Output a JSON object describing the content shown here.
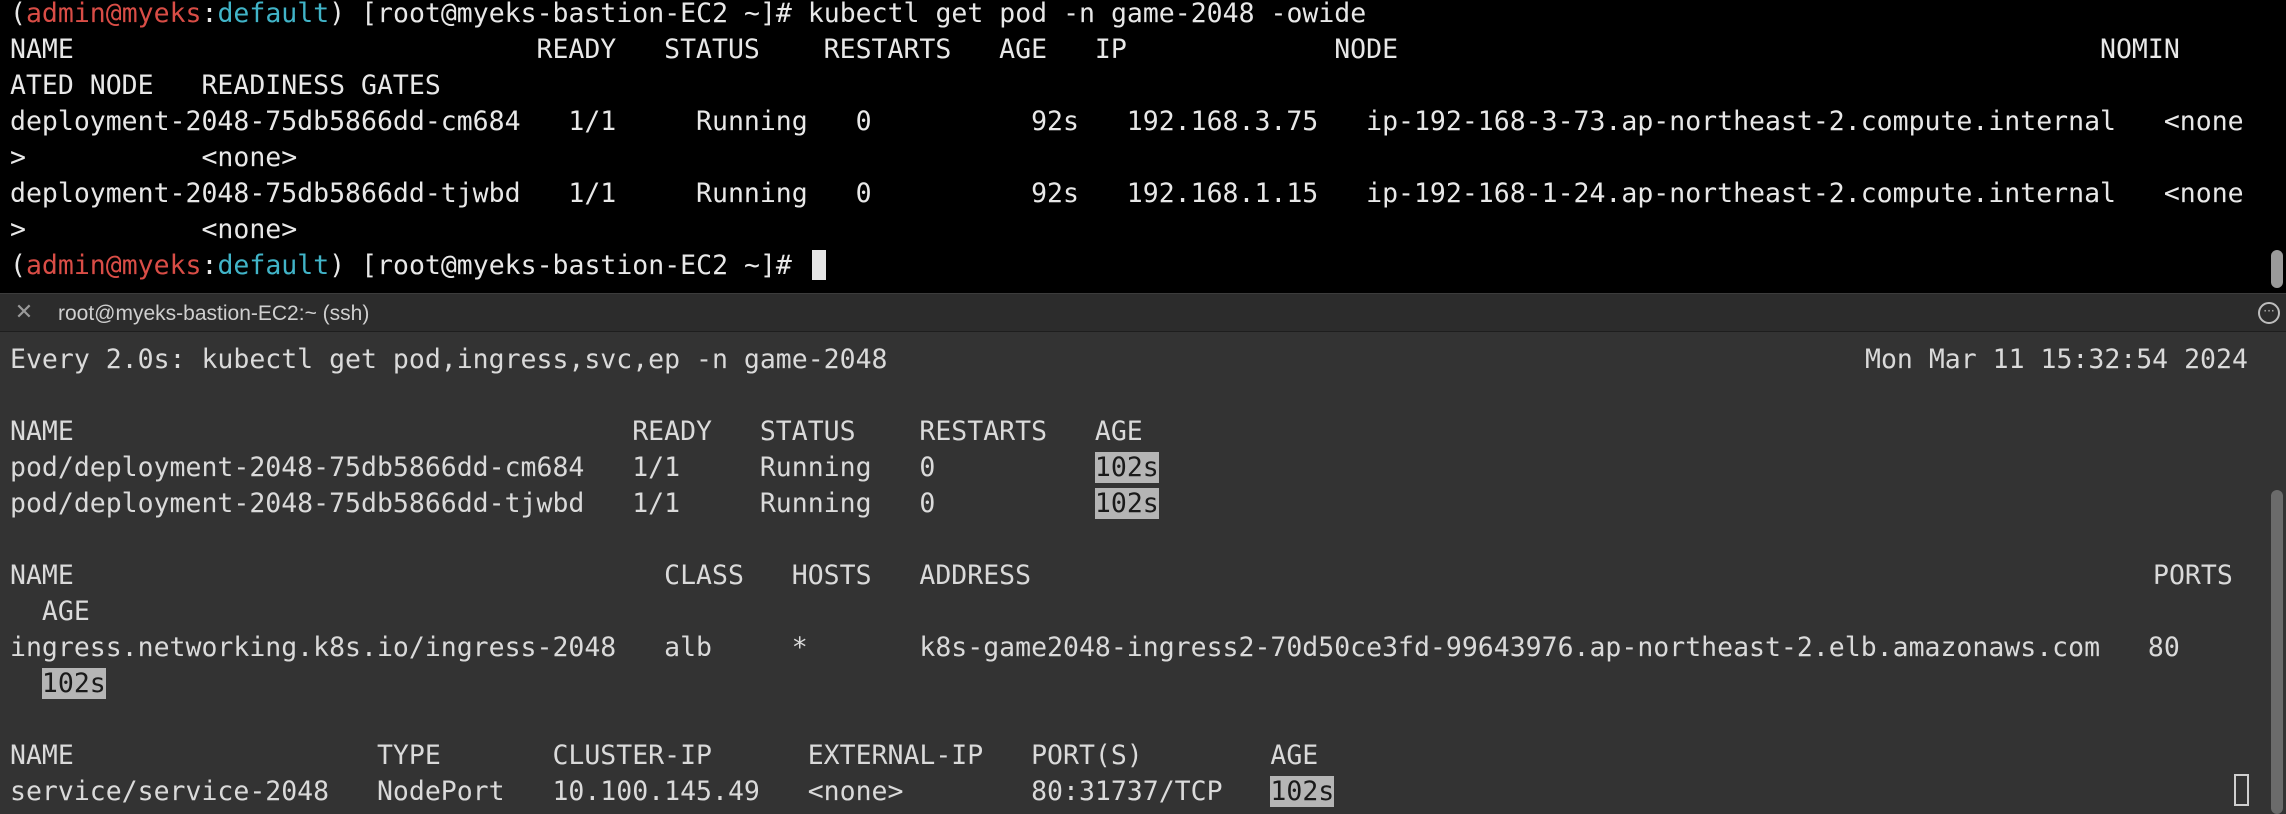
{
  "top": {
    "prompt": {
      "open": "(",
      "user": "admin",
      "at": "@",
      "cluster": "myeks",
      "colon": ":",
      "ns": "default",
      "close": ")",
      "rest": " [root@myeks-bastion-EC2 ~]# "
    },
    "command": "kubectl get pod -n game-2048 -owide",
    "header1": "NAME                             READY   STATUS    RESTARTS   AGE   IP             NODE                                            NOMIN",
    "header2": "ATED NODE   READINESS GATES",
    "rows": [
      "deployment-2048-75db5866dd-cm684   1/1     Running   0          92s   192.168.3.75   ip-192-168-3-73.ap-northeast-2.compute.internal   <none",
      ">           <none>",
      "deployment-2048-75db5866dd-tjwbd   1/1     Running   0          92s   192.168.1.15   ip-192-168-1-24.ap-northeast-2.compute.internal   <none",
      ">           <none>"
    ]
  },
  "tab": {
    "title": "root@myeks-bastion-EC2:~ (ssh)",
    "menu_glyph": "···"
  },
  "watch": {
    "command": "Every 2.0s: kubectl get pod,ingress,svc,ep -n game-2048",
    "timestamp": "Mon Mar 11 15:32:54 2024",
    "pod_header": "NAME                                   READY   STATUS    RESTARTS   AGE",
    "pods": [
      {
        "prefix": "pod/deployment-2048-75db5866dd-cm684   1/1     Running   0          ",
        "age": "102s"
      },
      {
        "prefix": "pod/deployment-2048-75db5866dd-tjwbd   1/1     Running   0          ",
        "age": "102s"
      }
    ],
    "ingress_header1": "NAME                                     CLASS   HOSTS   ADDRESS",
    "ingress_ports_label": "PORTS",
    "ingress_header2": "  AGE",
    "ingress_row": "ingress.networking.k8s.io/ingress-2048   alb     *       k8s-game2048-ingress2-70d50ce3fd-99643976.ap-northeast-2.elb.amazonaws.com   80",
    "ingress_age": "102s",
    "svc_header": "NAME                   TYPE       CLUSTER-IP      EXTERNAL-IP   PORT(S)        AGE",
    "svc_row_prefix": "service/service-2048   NodePort   10.100.145.49   <none>        80:31737/TCP   ",
    "svc_age": "102s"
  },
  "colors": {
    "user": "#d94d46",
    "cluster": "#d94d46",
    "namespace": "#41b4c8",
    "top_bg": "#000000",
    "bottom_bg": "#333333",
    "highlight": "#b5b5b5"
  }
}
